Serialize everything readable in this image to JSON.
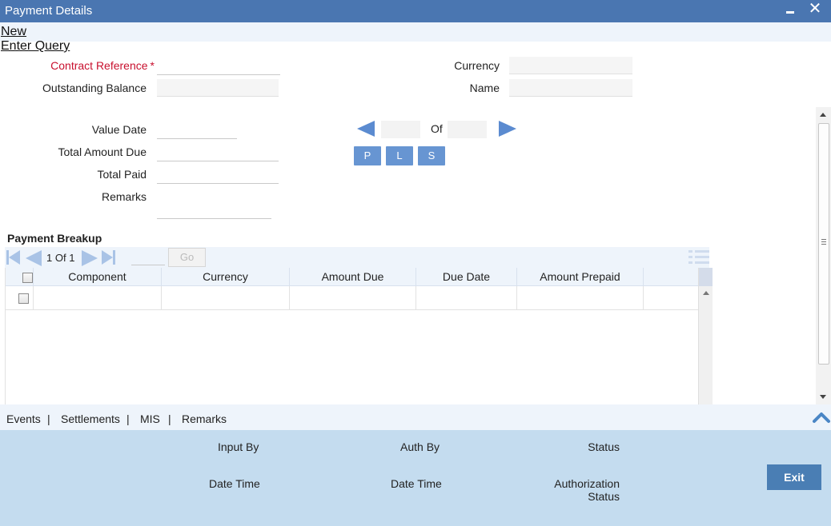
{
  "window": {
    "title": "Payment Details"
  },
  "menu": {
    "new_label": "New",
    "enter_query_label": "Enter Query"
  },
  "form": {
    "contract_reference_label": "Contract Reference",
    "required_marker": "*",
    "outstanding_balance_label": "Outstanding Balance",
    "currency_label": "Currency",
    "name_label": "Name",
    "value_date_label": "Value Date",
    "total_amount_due_label": "Total Amount Due",
    "total_paid_label": "Total Paid",
    "remarks_label": "Remarks"
  },
  "pager": {
    "of_label": "Of"
  },
  "buttons": {
    "p": "P",
    "l": "L",
    "s": "S"
  },
  "breakup": {
    "title": "Payment Breakup",
    "page_current": "1",
    "page_of": "Of",
    "page_total": "1",
    "go_label": "Go",
    "columns": [
      "Component",
      "Currency",
      "Amount Due",
      "Due Date",
      "Amount Prepaid"
    ]
  },
  "tabs": [
    "Events",
    "Settlements",
    "MIS",
    "Remarks"
  ],
  "tab_separator": "|",
  "footer": {
    "input_by_label": "Input By",
    "auth_by_label": "Auth By",
    "status_label": "Status",
    "date_time_label_1": "Date Time",
    "date_time_label_2": "Date Time",
    "authorization_label": "Authorization",
    "authorization_status_label": "Status",
    "exit_label": "Exit"
  },
  "icons": {
    "minimize": "minimize-icon",
    "close": "close-icon",
    "collapse": "chevron-up-icon",
    "grid_view": "list-view-icon"
  },
  "colors": {
    "title_bar": "#4a76b1",
    "required": "#c8102e",
    "action_button": "#6795d2",
    "footer_bg": "#c4dcef",
    "exit_button": "#4a7eb4"
  }
}
